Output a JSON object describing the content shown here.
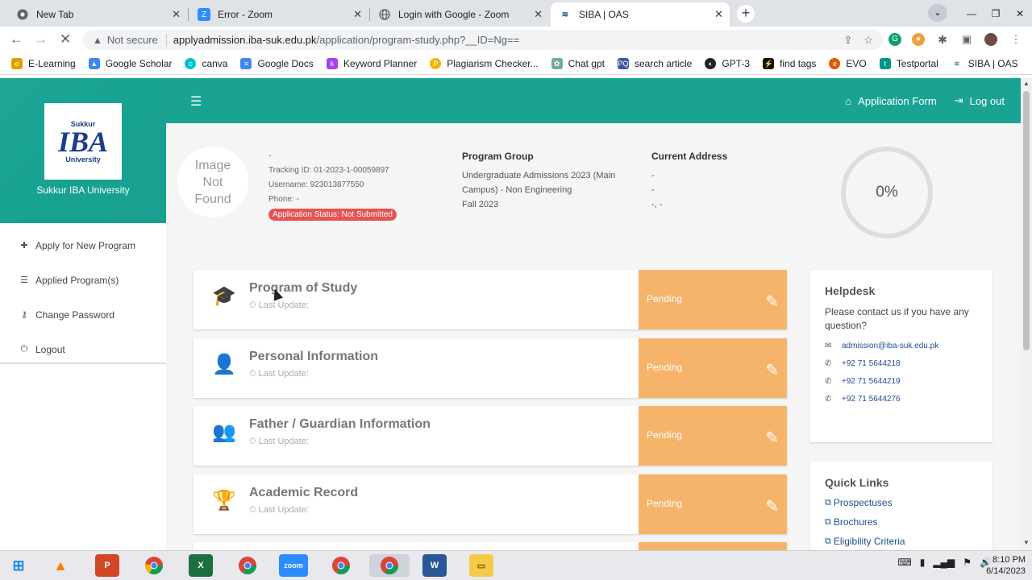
{
  "browser": {
    "tabs": [
      {
        "title": "New Tab",
        "icon": "chrome-icon"
      },
      {
        "title": "Error - Zoom",
        "icon": "zoom-icon"
      },
      {
        "title": "Login with Google - Zoom",
        "icon": "globe-icon"
      },
      {
        "title": "SIBA | OAS",
        "icon": "siba-icon"
      }
    ],
    "not_secure": "Not secure",
    "url_host": "applyadmission.iba-suk.edu.pk",
    "url_path": "/application/program-study.php?__ID=Ng==",
    "bookmarks": [
      {
        "label": "E-Learning",
        "color": "#e0a000"
      },
      {
        "label": "Google Scholar",
        "color": "#4285f4"
      },
      {
        "label": "canva",
        "color": "#00c4cc"
      },
      {
        "label": "Google Docs",
        "color": "#4285f4"
      },
      {
        "label": "Keyword Planner",
        "color": "#a142f4"
      },
      {
        "label": "Plagiarism Checker...",
        "color": "#f4b400"
      },
      {
        "label": "Chat gpt",
        "color": "#74aa9c"
      },
      {
        "label": "search article",
        "color": "#3b5998"
      },
      {
        "label": "GPT-3",
        "color": "#222222"
      },
      {
        "label": "find tags",
        "color": "#111111"
      },
      {
        "label": "EVO",
        "color": "#e05a00"
      },
      {
        "label": "Testportal",
        "color": "#009688"
      },
      {
        "label": "SIBA | OAS",
        "color": "#1d4f91"
      }
    ]
  },
  "sidebar": {
    "logo_top": "Sukkur",
    "logo_main": "IBA",
    "logo_bottom": "University",
    "brand_name": "Sukkur IBA University",
    "items": [
      {
        "label": "Apply for New Program",
        "icon": "plus-icon"
      },
      {
        "label": "Applied Program(s)",
        "icon": "list-icon"
      },
      {
        "label": "Change Password",
        "icon": "key-icon"
      },
      {
        "label": "Logout",
        "icon": "power-icon"
      }
    ]
  },
  "header": {
    "application_form": "Application Form",
    "logout": "Log out"
  },
  "profile": {
    "avatar_text": "Image Not Found",
    "name": "-",
    "tracking_id": "Tracking ID: 01-2023-1-00059897",
    "username": "Username: 923013877550",
    "phone": "Phone: -",
    "status": "Application Status: Not Submitted",
    "program_group_heading": "Program Group",
    "program_group_line1": "Undergraduate Admissions 2023 (Main",
    "program_group_line2": "Campus) - Non Engineering",
    "program_group_line3": "Fall 2023",
    "address_heading": "Current Address",
    "address_line1": "-",
    "address_line2": "-",
    "address_line3": "-, -",
    "progress": "0%"
  },
  "sections": [
    {
      "title": "Program of Study",
      "updated": "Last Update:",
      "status": "Pending",
      "icon": "graduation-cap-icon"
    },
    {
      "title": "Personal Information",
      "updated": "Last Update:",
      "status": "Pending",
      "icon": "user-icon"
    },
    {
      "title": "Father / Guardian Information",
      "updated": "Last Update:",
      "status": "Pending",
      "icon": "users-icon"
    },
    {
      "title": "Academic Record",
      "updated": "Last Update:",
      "status": "Pending",
      "icon": "trophy-icon"
    }
  ],
  "helpdesk": {
    "title": "Helpdesk",
    "text": "Please contact us if you have any question?",
    "email": "admission@iba-suk.edu.pk",
    "phones": [
      "+92 71 5644218",
      "+92 71 5644219",
      "+92 71 5644276"
    ]
  },
  "quick_links": {
    "title": "Quick Links",
    "links": [
      "Prospectuses",
      "Brochures",
      "Eligibility Criteria"
    ]
  },
  "taskbar": {
    "time": "8:10 PM",
    "date": "6/14/2023",
    "apps": [
      "windows-start",
      "vlc",
      "powerpoint",
      "chrome",
      "excel",
      "chrome",
      "zoom",
      "chrome",
      "chrome",
      "word",
      "file-explorer"
    ]
  }
}
